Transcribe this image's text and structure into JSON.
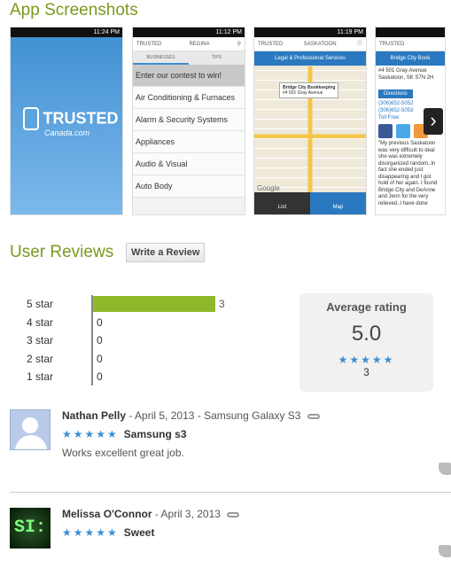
{
  "sections": {
    "screenshots_title": "App Screenshots",
    "reviews_title": "User Reviews",
    "write_review_label": "Write a Review"
  },
  "screenshots": {
    "time1": "11:24 PM",
    "time2": "11:12 PM",
    "time3": "11:19 PM",
    "logo_word": "TRUSTED",
    "logo_sub": "Canada.com",
    "shot2_brand": "TRUSTED",
    "shot2_city": "REGINA",
    "shot2_tabs": [
      "BUSINESSES",
      "TIPS"
    ],
    "shot2_menu": [
      "Enter our contest to win!",
      "Air Conditioning & Furnaces",
      "Alarm & Security Systems",
      "Appliances",
      "Audio & Visual",
      "Auto Body"
    ],
    "shot3_city": "SASKATOON",
    "shot3_category": "Legal & Professional Services",
    "shot3_popup_name": "Bridge City Bookkeeping",
    "shot3_popup_addr": "#4 501 Gray Avenue",
    "shot3_google": "Google",
    "shot3_tabs": [
      "List",
      "Map"
    ],
    "shot4_bar": "Bridge City Book",
    "shot4_addr": [
      "#4 501 Gray Avenue",
      "Saskatoon, SK S7N 2H"
    ],
    "shot4_dir": "Directions",
    "shot4_phones": [
      "(306)652-5052",
      "(306)652-5053",
      "Toll Free:"
    ],
    "shot4_review": "\"My previous Saskatoon was very difficult to deal she was extremely disorganized random..In fact she ended just disappearing and I got hold of her again. I found Bridge City and DeAnne and Jenn for the very relieved..I have done"
  },
  "histogram": {
    "rows": [
      {
        "label": "5 star",
        "count": "3",
        "fraction": 1.0
      },
      {
        "label": "4 star",
        "count": "0",
        "fraction": 0
      },
      {
        "label": "3 star",
        "count": "0",
        "fraction": 0
      },
      {
        "label": "2 star",
        "count": "0",
        "fraction": 0
      },
      {
        "label": "1 star",
        "count": "0",
        "fraction": 0
      }
    ]
  },
  "average": {
    "title": "Average rating",
    "value": "5.0",
    "stars": "★★★★★",
    "count": "3"
  },
  "reviews": [
    {
      "author": "Nathan Pelly",
      "meta": " - April 5, 2013 - Samsung Galaxy S3",
      "stars": "★★★★★",
      "title": "Samsung s3",
      "body": "Works excellent great job."
    },
    {
      "author": "Melissa O'Connor",
      "meta": " - April 3, 2013",
      "stars": "★★★★★",
      "title": "Sweet",
      "body": "",
      "avatar_text": "SI:"
    }
  ],
  "colors": {
    "accent_green": "#7a9a1f",
    "bar_green": "#8fb82a",
    "star_blue": "#3b8fd3"
  }
}
